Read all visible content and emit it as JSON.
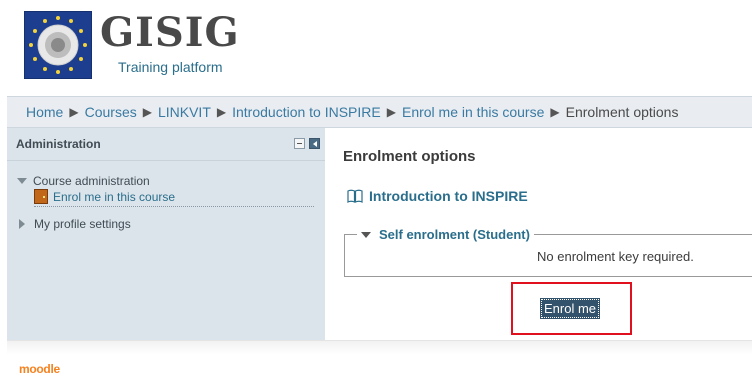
{
  "site": {
    "name": "GISIG",
    "subtitle": "Training platform"
  },
  "breadcrumb": [
    "Home",
    "Courses",
    "LINKVIT",
    "Introduction to INSPIRE",
    "Enrol me in this course",
    "Enrolment options"
  ],
  "admin": {
    "title": "Administration",
    "course_admin": "Course administration",
    "enrol_link": "Enrol me in this course",
    "profile_settings": "My profile settings"
  },
  "main": {
    "title": "Enrolment options",
    "course_name": "Introduction to INSPIRE",
    "self_enrol_legend": "Self enrolment (Student)",
    "no_key_text": "No enrolment key required.",
    "enrol_button": "Enrol me"
  },
  "footer": {
    "logo_text": "moodle"
  },
  "colors": {
    "link": "#2a6e8c",
    "highlight_border": "#e0101e",
    "button_bg": "#33526b"
  }
}
